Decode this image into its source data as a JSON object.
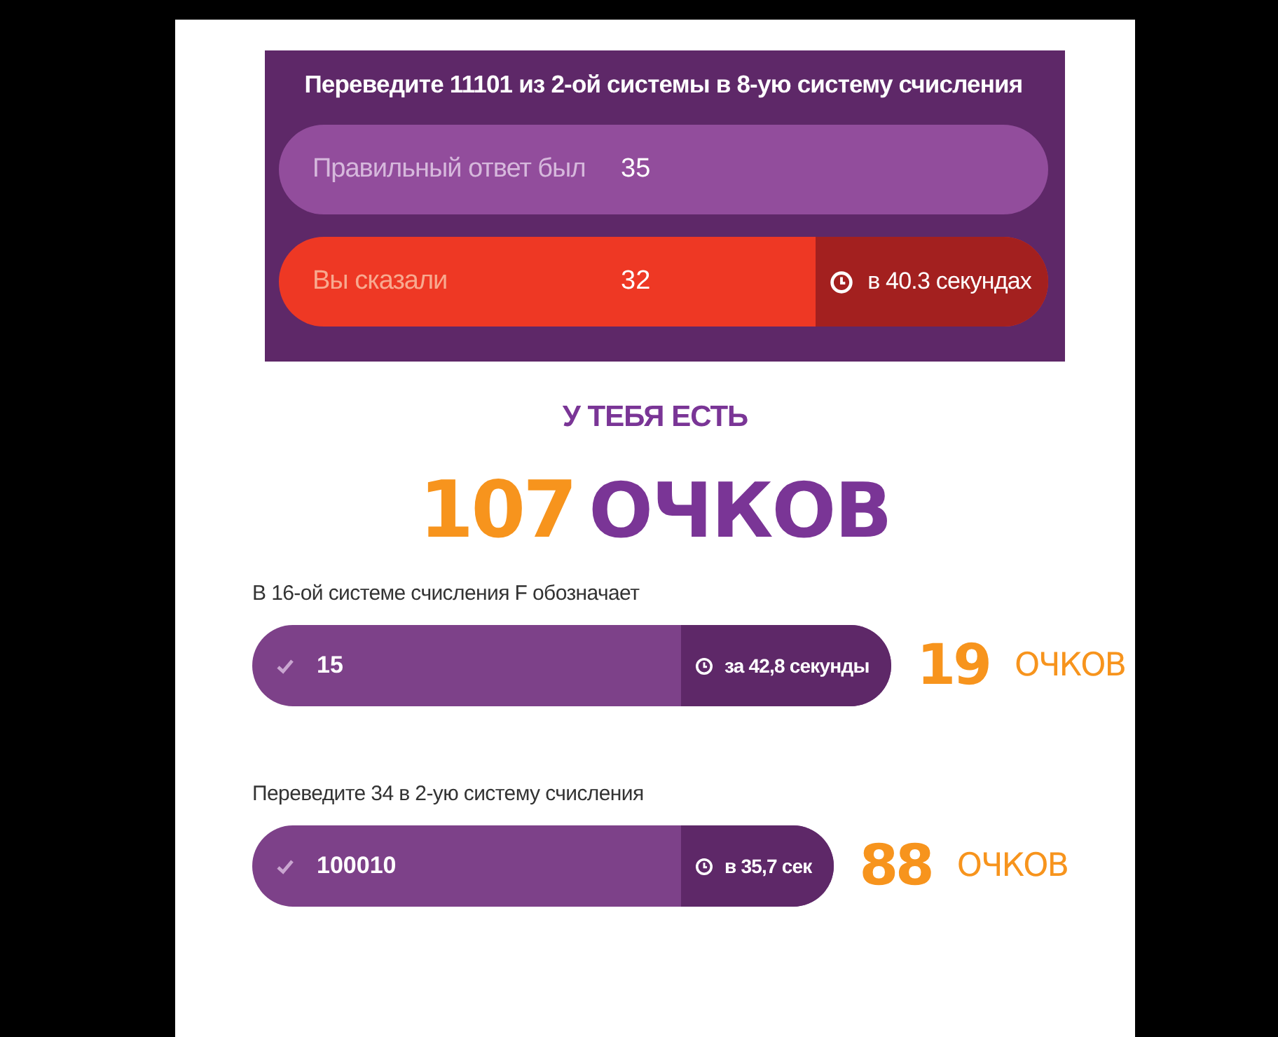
{
  "result": {
    "question": "Переведите 11101 из 2-ой системы в 8-ую систему счисления",
    "correct_label": "Правильный ответ был",
    "correct_answer": "35",
    "your_label": "Вы сказали",
    "your_answer": "32",
    "time": "в 40.3 секундах",
    "correct": false
  },
  "score_header": "У ТЕБЯ ЕСТЬ",
  "score": {
    "points": "107",
    "unit": "ОЧКОВ"
  },
  "answers": [
    {
      "question": "В 16-ой системе счисления F обозначает",
      "answer": "15",
      "correct": true,
      "time": "за 42,8 секунды",
      "points": "19",
      "unit": "ОЧКОВ"
    },
    {
      "question": "Переведите 34 в 2-ую систему счисления",
      "answer": "100010",
      "correct": true,
      "time": "в 35,7 сек",
      "points": "88",
      "unit": "ОЧКОВ"
    }
  ]
}
